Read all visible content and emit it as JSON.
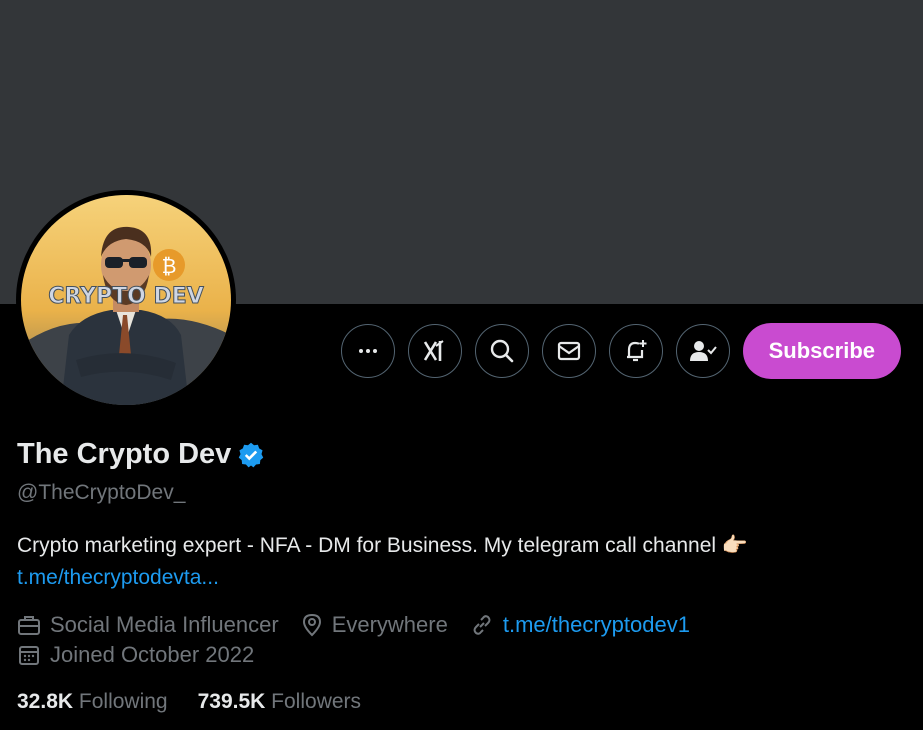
{
  "profile": {
    "name": "The Crypto Dev",
    "handle": "@TheCryptoDev_",
    "bio_text": "Crypto marketing expert - NFA - DM for Business. My telegram call channel 👉🏻",
    "bio_link": "t.me/thecryptodevta...",
    "category": "Social Media Influencer",
    "location": "Everywhere",
    "website": "t.me/thecryptodev1",
    "joined": "Joined October 2022",
    "following_count": "32.8K",
    "following_label": "Following",
    "followers_count": "739.5K",
    "followers_label": "Followers",
    "avatar_text": "CRYPTO DEV"
  },
  "actions": {
    "more": "more-icon",
    "grok": "grok-icon",
    "search": "search-icon",
    "message": "mail-icon",
    "notify": "bell-plus-icon",
    "following": "person-check-icon",
    "subscribe_label": "Subscribe"
  },
  "colors": {
    "accent_link": "#1d9bf0",
    "subscribe_bg": "#c94bd0",
    "banner": "#333639",
    "verified": "#1d9bf0"
  }
}
